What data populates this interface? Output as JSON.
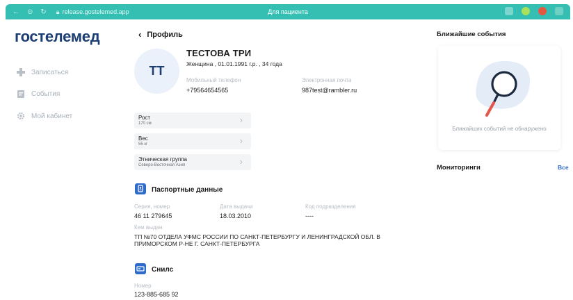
{
  "browser": {
    "url": "release.gostelemed.app",
    "title": "Для пациента"
  },
  "sidebar": {
    "logo": "гостелемед",
    "items": [
      {
        "label": "Записаться",
        "icon": "plus-icon"
      },
      {
        "label": "События",
        "icon": "calendar-icon"
      },
      {
        "label": "Мой кабинет",
        "icon": "gear-icon"
      }
    ]
  },
  "profile": {
    "back_label": "Профиль",
    "initials": "ТТ",
    "name": "ТЕСТОВА ТРИ",
    "info": "Женщина , 01.01.1991 г.р. , 34 года",
    "phone_label": "Мобильный телефон",
    "phone": "+79564654565",
    "email_label": "Электронная почта",
    "email": "987test@rambler.ru"
  },
  "metrics": [
    {
      "label": "Рост",
      "value": "170 см"
    },
    {
      "label": "Вес",
      "value": "55 кг"
    },
    {
      "label": "Этническая группа",
      "value": "Северо-Восточная Азия"
    }
  ],
  "passport": {
    "title": "Паспортные данные",
    "series_label": "Серия, номер",
    "series": "46 11 279645",
    "date_label": "Дата выдачи",
    "date": "18.03.2010",
    "code_label": "Код подразделения",
    "code": "----",
    "issued_label": "Кем выдан",
    "issued": "ТП №70 ОТДЕЛА УФМС РОССИИ ПО САНКТ-ПЕТЕРБУРГУ И ЛЕНИНГРАДСКОЙ ОБЛ. В ПРИМОРСКОМ Р-НЕ Г. САНКТ-ПЕТЕРБУРГА"
  },
  "snils": {
    "title": "Снилс",
    "number_label": "Номер",
    "number": "123-885-685 92"
  },
  "events": {
    "title": "Ближайшие события",
    "empty_text": "Ближайших событий не обнаружено"
  },
  "monitoring": {
    "title": "Мониторинги",
    "all_label": "Все"
  },
  "colors": {
    "browser_bar": "#35bfb2",
    "brand": "#1d3e72",
    "accent": "#2f6cc9"
  }
}
